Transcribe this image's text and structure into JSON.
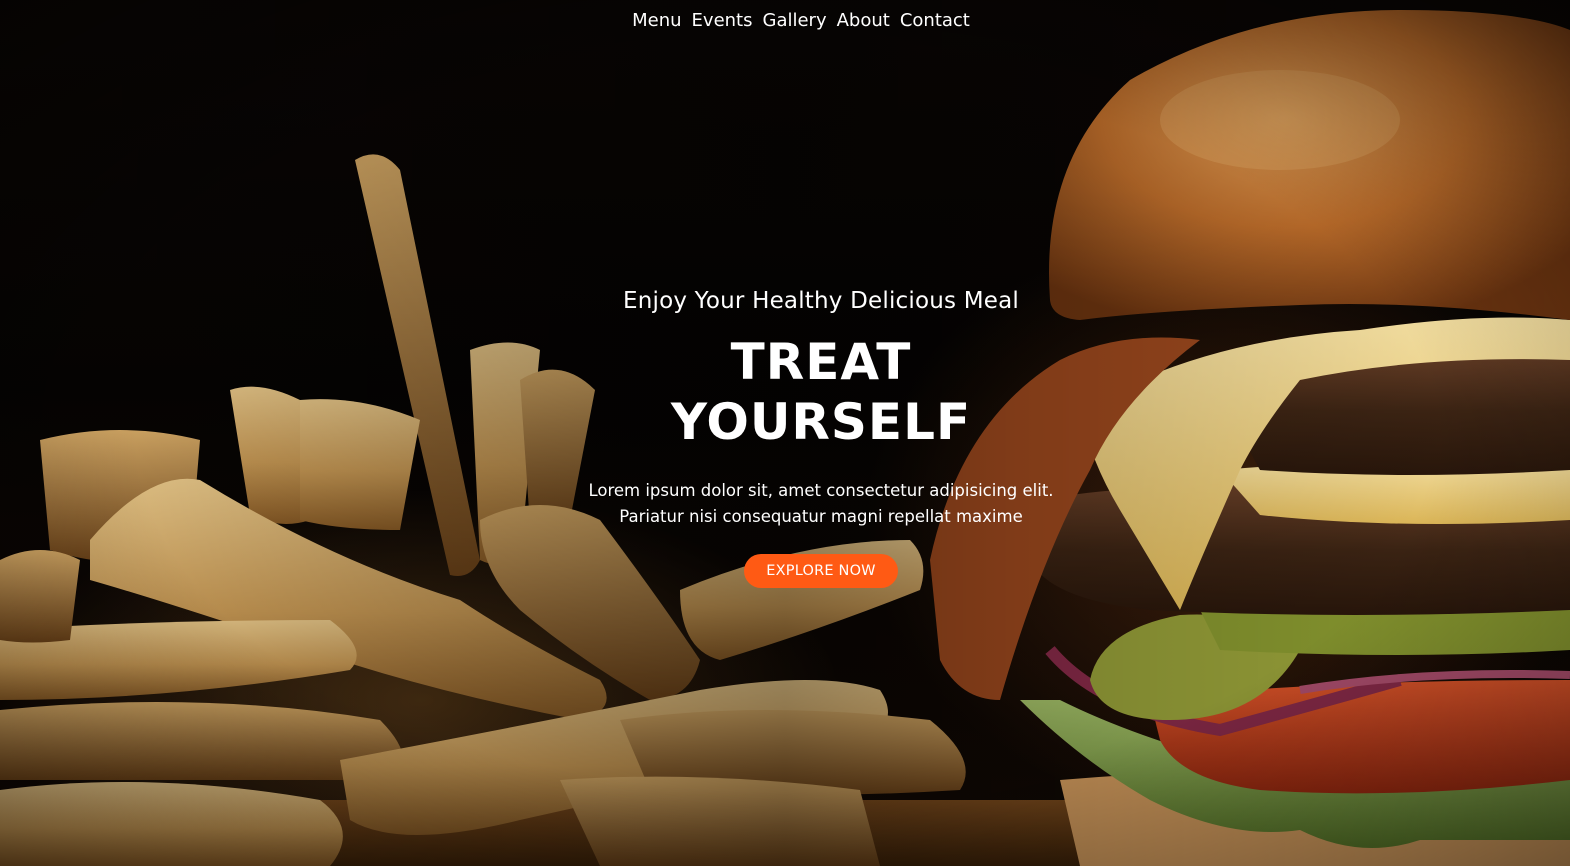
{
  "nav": {
    "items": [
      "Menu",
      "Events",
      "Gallery",
      "About",
      "Contact"
    ]
  },
  "hero": {
    "tagline": "Enjoy Your Healthy Delicious Meal",
    "headline_line1": "TREAT",
    "headline_line2": "YOURSELF",
    "description_line1": "Lorem ipsum dolor sit, amet consectetur adipisicing elit.",
    "description_line2": "Pariatur nisi consequatur magni repellat maxime",
    "cta_label": "EXPLORE NOW"
  },
  "colors": {
    "accent": "#ff5a14",
    "text": "#ffffff",
    "background": "#050403"
  },
  "background_image": "burger-and-fries-photo"
}
